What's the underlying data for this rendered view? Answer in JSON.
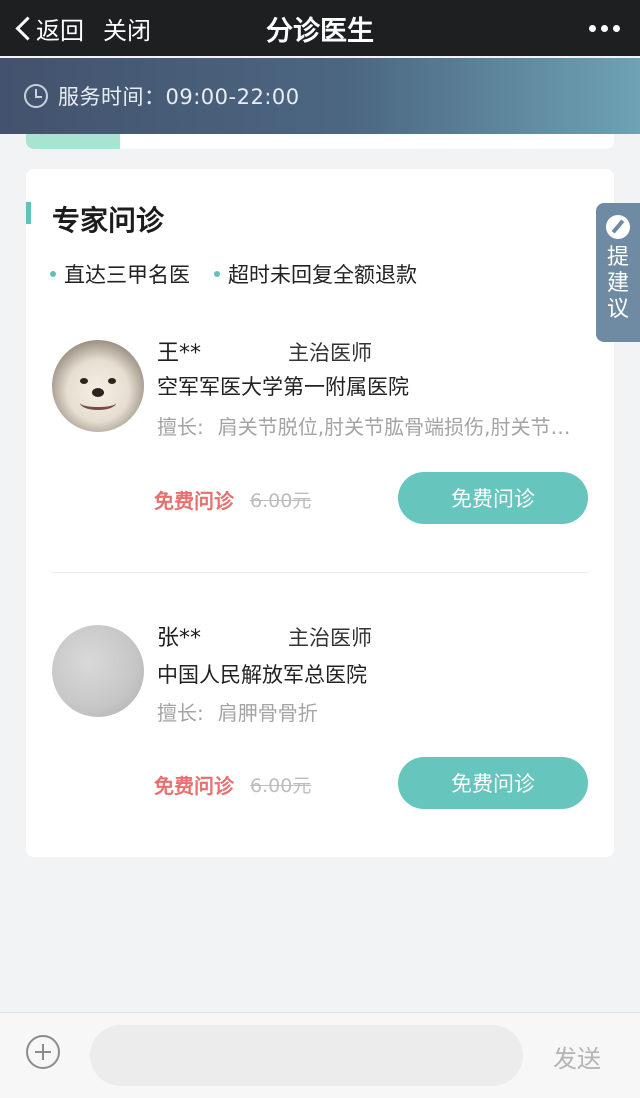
{
  "nav": {
    "back_label": "返回",
    "close_label": "关闭",
    "title": "分诊医生"
  },
  "service": {
    "text": "服务时间：09:00-22:00"
  },
  "previous_card": {
    "progress": 0.16
  },
  "expert": {
    "title": "专家问诊",
    "features": [
      "直达三甲名医",
      "超时未回复全额退款"
    ],
    "doctors": [
      {
        "name": "王**",
        "title": "主治医师",
        "hospital": "空军军医大学第一附属医院",
        "specialty_label": "擅长:",
        "specialty": "肩关节脱位,肘关节肱骨端损伤,肘关节内侧损伤",
        "price_free": "免费问诊",
        "price_old": "6.00元",
        "button": "免费问诊",
        "avatar": "dog-photo"
      },
      {
        "name": "张**",
        "title": "主治医师",
        "hospital": "中国人民解放军总医院",
        "specialty_label": "擅长:",
        "specialty": "肩胛骨骨折",
        "price_free": "免费问诊",
        "price_old": "6.00元",
        "button": "免费问诊",
        "avatar": "blank-photo"
      }
    ]
  },
  "suggestion": {
    "label": "提建议",
    "icon": "pencil-icon"
  },
  "input_bar": {
    "placeholder": "",
    "send_label": "发送"
  },
  "colors": {
    "accent": "#66c5bd",
    "price_red": "#e7706f",
    "nav_bg": "#1e1f21"
  }
}
